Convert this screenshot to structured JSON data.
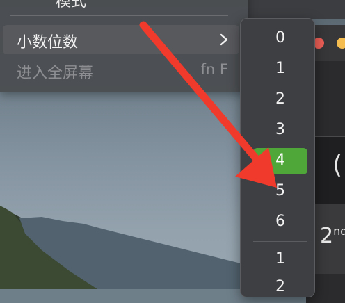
{
  "menu": {
    "partial_item_label": "模式",
    "items": [
      {
        "label": "小数位数",
        "state": "highlighted",
        "has_submenu": true,
        "chevron_icon": "chevron-right-icon"
      },
      {
        "label": "进入全屏幕",
        "state": "disabled",
        "shortcut": "fn F"
      }
    ]
  },
  "submenu": {
    "options": [
      "0",
      "1",
      "2",
      "3",
      "4",
      "5",
      "6"
    ],
    "selected": "4",
    "extra_options": [
      "1",
      "2"
    ]
  },
  "app_window": {
    "display_text": "(",
    "key_label_main": "2",
    "key_label_sup": "nd"
  },
  "annotation": {
    "type": "arrow",
    "color": "#f03a2b",
    "points_to": "5"
  },
  "colors": {
    "menu_bg": "#4a4c50",
    "selected_bg": "#4fa73a",
    "close": "#ee5f57",
    "minimize": "#f5bd4f"
  }
}
